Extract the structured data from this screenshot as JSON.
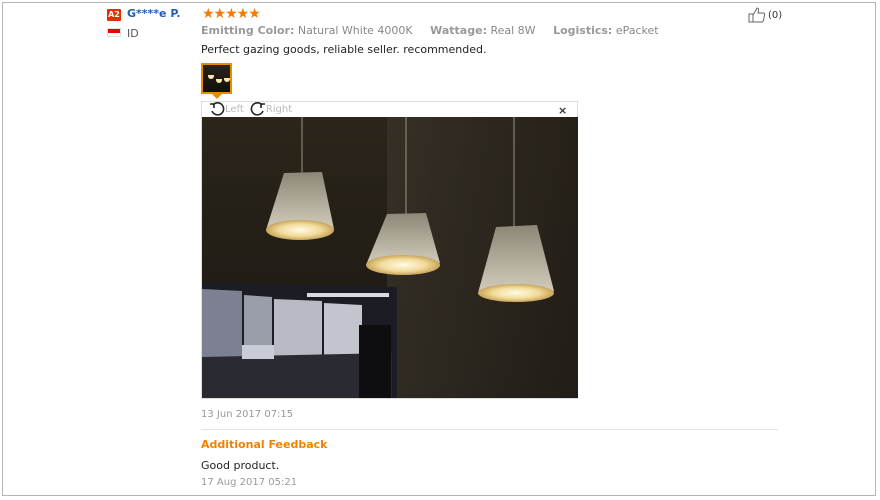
{
  "reviewer": {
    "level_badge": "A2",
    "name": "G****e P.",
    "country": "ID"
  },
  "rating": {
    "stars": "★★★★★",
    "value": 5
  },
  "attributes": [
    {
      "label": "Emitting Color:",
      "value": "Natural White 4000K"
    },
    {
      "label": "Wattage:",
      "value": "Real 8W"
    },
    {
      "label": "Logistics:",
      "value": "ePacket"
    }
  ],
  "review_text": "Perfect gazing goods, reliable seller. recommended.",
  "viewer": {
    "rotate_left": "Left",
    "rotate_right": "Right",
    "close": "×"
  },
  "review_date": "13 Jun 2017 07:15",
  "additional": {
    "heading": "Additional Feedback",
    "text": "Good product.",
    "date": "17 Aug 2017 05:21"
  },
  "helpful": {
    "count": "(0)"
  },
  "colors": {
    "accent": "#f08200",
    "name_link": "#1f5fb1",
    "badge": "#e62e04"
  }
}
